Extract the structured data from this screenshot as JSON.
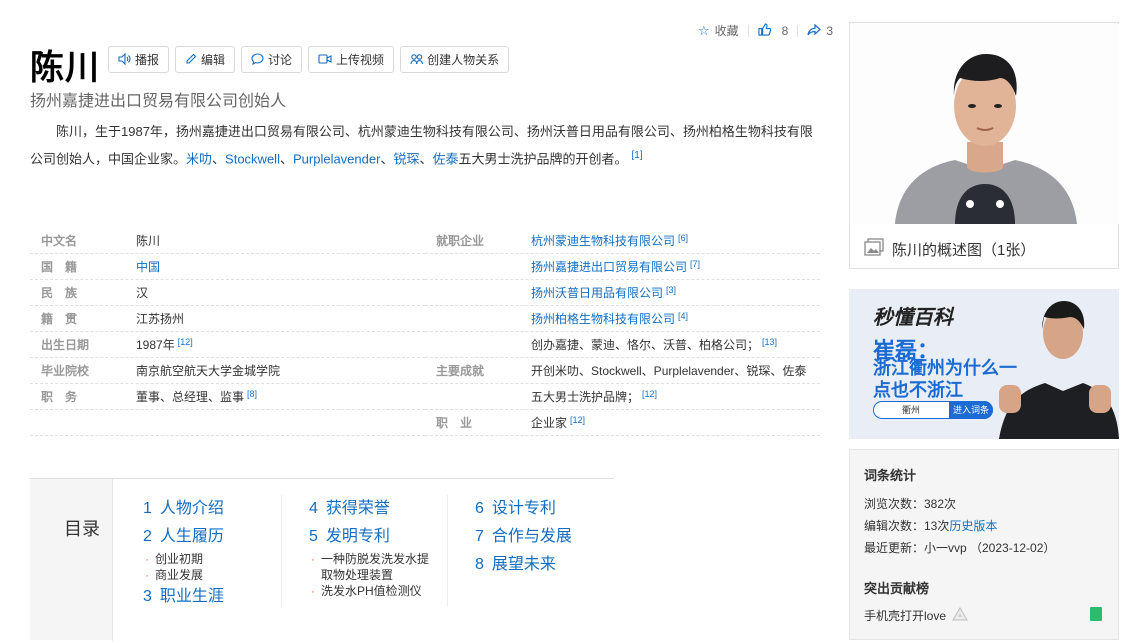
{
  "actions": {
    "collect": "收藏",
    "likes": "8",
    "shares": "3"
  },
  "title": "陈川",
  "toolbar": [
    "播报",
    "编辑",
    "讨论",
    "上传视频",
    "创建人物关系"
  ],
  "subtitle": "扬州嘉捷进出口贸易有限公司创始人",
  "summary": {
    "p1": "陈川，生于1987年，扬州嘉捷进出口贸易有限公司、杭州蒙迪生物科技有限公司、扬州沃普日用品有限公司、扬州柏格生物科技有限公司创始人，中国企业家。",
    "brands": [
      "米叻",
      "Stockwell",
      "Purplelavender",
      "锐琛",
      "佐泰"
    ],
    "sep": "、",
    "tail": "五大男士洗护品牌的开创者。",
    "ref": "[1]"
  },
  "infobox": {
    "left": [
      {
        "label": "中文名",
        "value": "陈川",
        "ref": ""
      },
      {
        "label": "国　籍",
        "value": "中国",
        "ref": "",
        "link": true
      },
      {
        "label": "民　族",
        "value": "汉",
        "ref": ""
      },
      {
        "label": "籍　贯",
        "value": "江苏扬州",
        "ref": ""
      },
      {
        "label": "出生日期",
        "value": "1987年",
        "ref": "[12]"
      },
      {
        "label": "毕业院校",
        "value": "南京航空航天大学金城学院",
        "ref": ""
      },
      {
        "label": "职　务",
        "value": "董事、总经理、监事",
        "ref": "[8]"
      }
    ],
    "right": [
      {
        "label": "就职企业",
        "value": "杭州蒙迪生物科技有限公司",
        "ref": "[6]",
        "link": true
      },
      {
        "label": "",
        "value": "扬州嘉捷进出口贸易有限公司",
        "ref": "[7]",
        "link": true
      },
      {
        "label": "",
        "value": "扬州沃普日用品有限公司",
        "ref": "[3]",
        "link": true
      },
      {
        "label": "",
        "value": "扬州柏格生物科技有限公司",
        "ref": "[4]",
        "link": true
      },
      {
        "label": "",
        "value": "创办嘉捷、蒙迪、恪尔、沃普、柏格公司；",
        "ref": "[13]"
      },
      {
        "label": "主要成就",
        "value": "开创米叻、Stockwell、Purplelavender、锐琛、佐泰",
        "ref": ""
      },
      {
        "label": "",
        "value": "五大男士洗护品牌；",
        "ref": "[12]"
      },
      {
        "label": "职　业",
        "value": "企业家",
        "ref": "[12]"
      }
    ]
  },
  "catalog": {
    "title": "目录",
    "col1": [
      {
        "num": "1",
        "label": "人物介绍",
        "subs": []
      },
      {
        "num": "2",
        "label": "人生履历",
        "subs": [
          "创业初期",
          "商业发展"
        ]
      },
      {
        "num": "3",
        "label": "职业生涯",
        "subs": []
      }
    ],
    "col2": [
      {
        "num": "4",
        "label": "获得荣誉",
        "subs": []
      },
      {
        "num": "5",
        "label": "发明专利",
        "subs": [
          "一种防脱发洗发水提取物处理装置",
          "洗发水PH值检测仪"
        ]
      }
    ],
    "col3": [
      {
        "num": "6",
        "label": "设计专利",
        "subs": []
      },
      {
        "num": "7",
        "label": "合作与发展",
        "subs": []
      },
      {
        "num": "8",
        "label": "展望未来",
        "subs": []
      }
    ]
  },
  "photo": {
    "caption": "陈川的概述图（1张）"
  },
  "ad": {
    "logo": "秒懂百科",
    "line1": "崔磊：",
    "line2": "浙江衢州为什么一点也不浙江",
    "search": "衢州",
    "btn": "进入词条"
  },
  "stats": {
    "title": "词条统计",
    "views": "浏览次数：382次",
    "edits_prefix": "编辑次数：13次",
    "history": "历史版本",
    "updated": "最近更新：小一vvp （2023-12-02）",
    "contrib_title": "突出贡献榜",
    "contrib_user": "手机壳打开love"
  },
  "colors": {
    "link": "#136ec2",
    "label": "#999999",
    "accent_green": "#2dbb6d"
  }
}
